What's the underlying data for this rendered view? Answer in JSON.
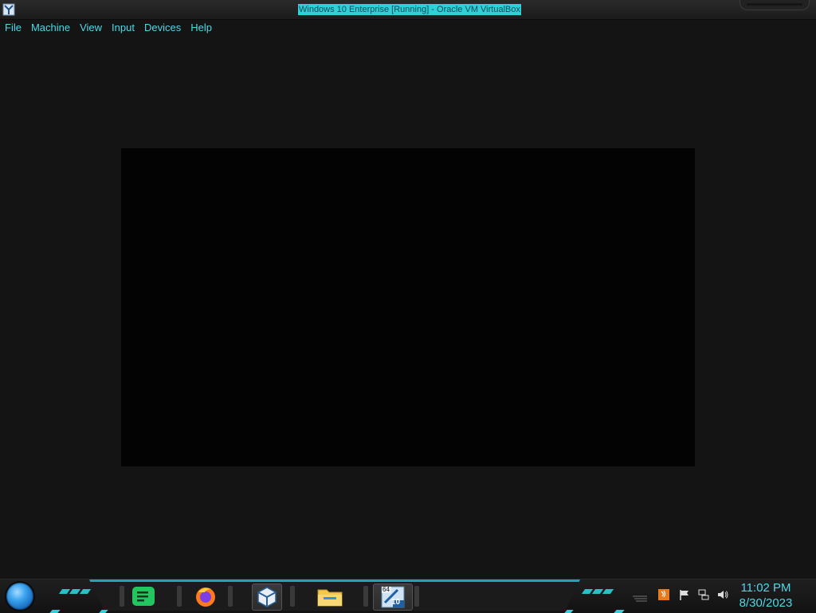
{
  "window": {
    "title": "Windows 10 Enterprise [Running] - Oracle VM VirtualBox",
    "app_icon": "virtualbox-icon"
  },
  "menu": {
    "items": [
      {
        "label": "File"
      },
      {
        "label": "Machine"
      },
      {
        "label": "View"
      },
      {
        "label": "Input"
      },
      {
        "label": "Devices"
      },
      {
        "label": "Help"
      }
    ]
  },
  "taskbar": {
    "start_icon": "start-orb-icon",
    "pinned": [
      {
        "name": "notes-app-icon"
      },
      {
        "name": "firefox-icon"
      },
      {
        "name": "virtualbox-icon"
      },
      {
        "name": "file-explorer-icon"
      },
      {
        "name": "windows10-vm-icon",
        "badge_top": "64",
        "badge_bottom": "10"
      }
    ],
    "tray": [
      {
        "name": "java-icon"
      },
      {
        "name": "action-center-flag-icon"
      },
      {
        "name": "network-icon"
      },
      {
        "name": "volume-icon"
      }
    ],
    "clock": {
      "time": "11:02 PM",
      "date": "8/30/2023"
    }
  },
  "colors": {
    "accent": "#2fd0d8",
    "menu_text": "#4fd8e6",
    "background": "#141414",
    "vm_screen": "#030303"
  }
}
